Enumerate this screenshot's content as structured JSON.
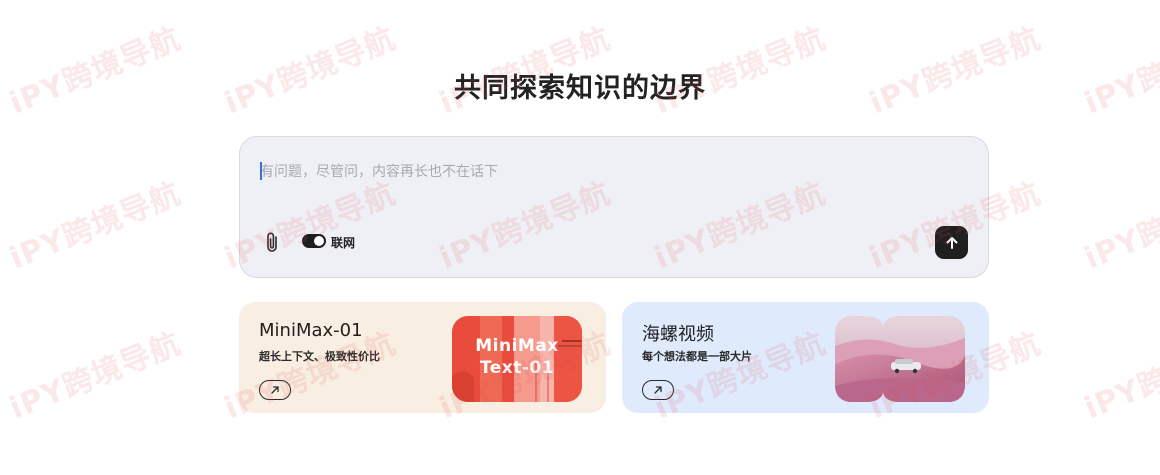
{
  "hero": {
    "title": "共同探索知识的边界"
  },
  "chat": {
    "placeholder": "有问题，尽管问，内容再长也不在话下",
    "web_toggle_label": "联网",
    "web_toggle_on": true
  },
  "cards": [
    {
      "title": "MiniMax-01",
      "subtitle": "超长上下文、极致性价比",
      "thumb_line1": "MiniMax",
      "thumb_line2": "Text-01"
    },
    {
      "title": "海螺视频",
      "subtitle": "每个想法都是一部大片"
    }
  ],
  "watermark": {
    "text": "iPY跨境导航"
  },
  "icons": {
    "attach": "paperclip-icon",
    "send": "arrow-up-icon",
    "open": "arrow-up-right-icon"
  },
  "colors": {
    "accent_dark": "#1f1f1f",
    "chat_bg": "#eff0f5",
    "card1_bg": "#f8eee2",
    "card2_bg": "#dfeafc",
    "thumb_red": "#e94b3c"
  }
}
